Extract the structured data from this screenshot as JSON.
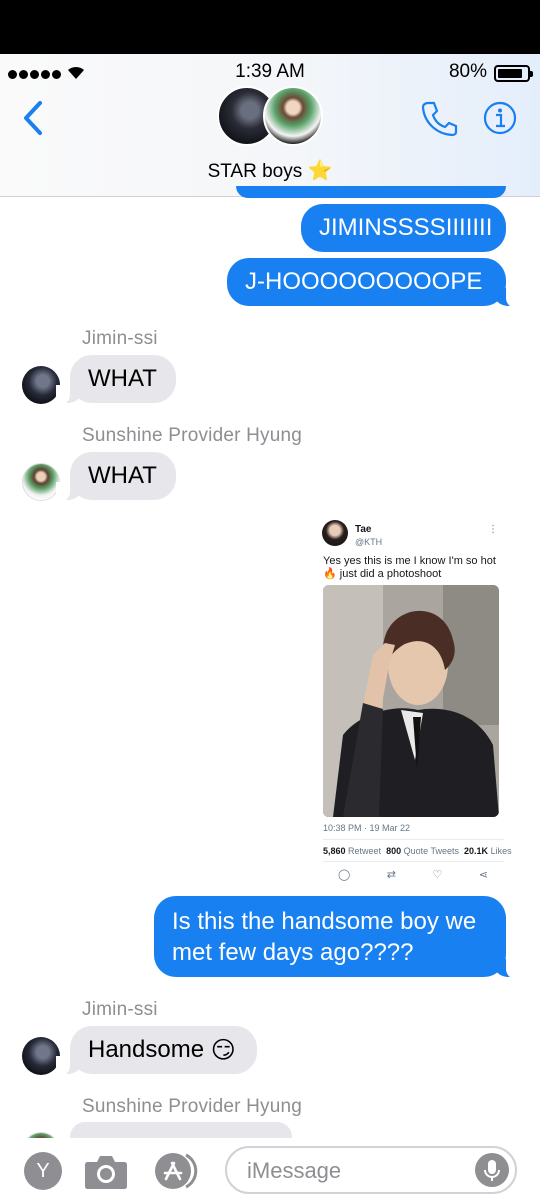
{
  "status": {
    "time": "1:39 AM",
    "battery": "80%"
  },
  "header": {
    "group_name": "STAR boys",
    "group_emoji": "⭐"
  },
  "messages": {
    "out1": "JIMINSSSSIIIIIII",
    "out2": "J-HOOOOOOOOOPE",
    "jimin_name": "Jimin-ssi",
    "in1": "WHAT",
    "hobi_name": "Sunshine Provider Hyung",
    "in2": "WHAT",
    "out3_line1": "Is this the handsome boy we",
    "out3_line2": "met few days ago????",
    "jimin_name2": "Jimin-ssi",
    "in3": "Handsome",
    "in3_emoji": "😏",
    "hobi_name2": "Sunshine Provider Hyung"
  },
  "tweet": {
    "name": "Tae",
    "handle": "@KTH",
    "text_line1": "Yes yes this is me I know I'm so hot",
    "text_line2": "just did a photoshoot",
    "fire_emoji": "🔥",
    "time": "10:38 PM · 19 Mar 22",
    "retweets": "5,860",
    "retweets_label": "Retweet",
    "quotes": "800",
    "quotes_label": "Quote Tweets",
    "likes": "20.1K",
    "likes_label": "Likes"
  },
  "composer": {
    "placeholder": "iMessage",
    "y_label": "Y"
  }
}
